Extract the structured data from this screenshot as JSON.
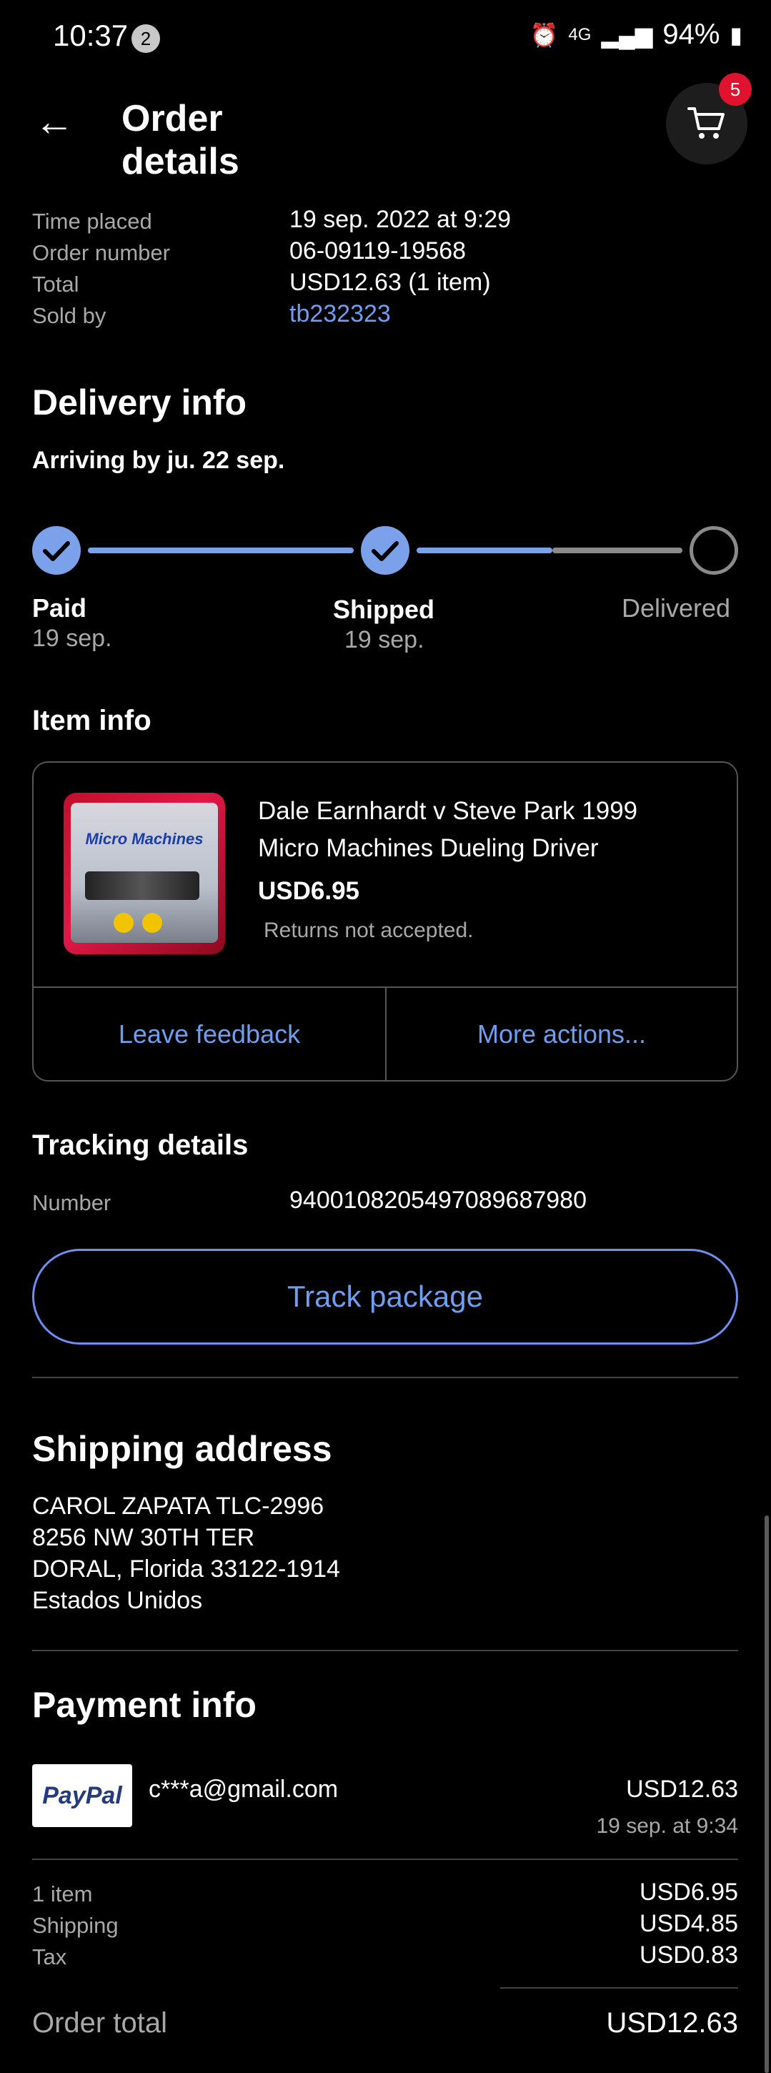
{
  "status_bar": {
    "time": "10:37",
    "notification_count": "2",
    "network": "4G",
    "battery": "94%"
  },
  "header": {
    "title": "Order details",
    "cart_badge": "5"
  },
  "order": {
    "time_placed_label": "Time placed",
    "time_placed": "19 sep. 2022 at 9:29",
    "order_number_label": "Order number",
    "order_number": "06-09119-19568",
    "total_label": "Total",
    "total": "USD12.63 (1 item)",
    "sold_by_label": "Sold by",
    "sold_by": "tb232323"
  },
  "delivery": {
    "heading": "Delivery info",
    "arriving": "Arriving by ju. 22 sep.",
    "progress_fraction": 0.78,
    "steps": [
      {
        "label": "Paid",
        "date": "19 sep."
      },
      {
        "label": "Shipped",
        "date": "19 sep."
      },
      {
        "label": "Delivered",
        "date": ""
      }
    ]
  },
  "item": {
    "heading": "Item info",
    "title_line1": "Dale Earnhardt v Steve Park 1999",
    "title_line2": "Micro Machines Dueling Driver",
    "price": "USD6.95",
    "returns": "Returns not accepted.",
    "image_text": "Micro Machines",
    "leave_feedback": "Leave feedback",
    "more_actions": "More actions..."
  },
  "tracking": {
    "heading": "Tracking details",
    "number_label": "Number",
    "number": "9400108205497089687980",
    "track_button": "Track package"
  },
  "shipping": {
    "heading": "Shipping address",
    "line1": "CAROL ZAPATA TLC-2996",
    "line2": "8256 NW 30TH TER",
    "line3": "DORAL, Florida 33122-1914",
    "line4": "Estados Unidos"
  },
  "payment": {
    "heading": "Payment info",
    "method": "PayPal",
    "email": "c***a@gmail.com",
    "amount": "USD12.63",
    "paid_at": "19 sep. at 9:34",
    "items_label": "1 item",
    "items_value": "USD6.95",
    "shipping_label": "Shipping",
    "shipping_value": "USD4.85",
    "tax_label": "Tax",
    "tax_value": "USD0.83",
    "order_total_label": "Order total",
    "order_total_value": "USD12.63"
  },
  "colors": {
    "accent": "#6f9eee",
    "progress_done": "#7ba1ea",
    "progress_pending": "#8a8a8a",
    "badge": "#e0122d"
  }
}
